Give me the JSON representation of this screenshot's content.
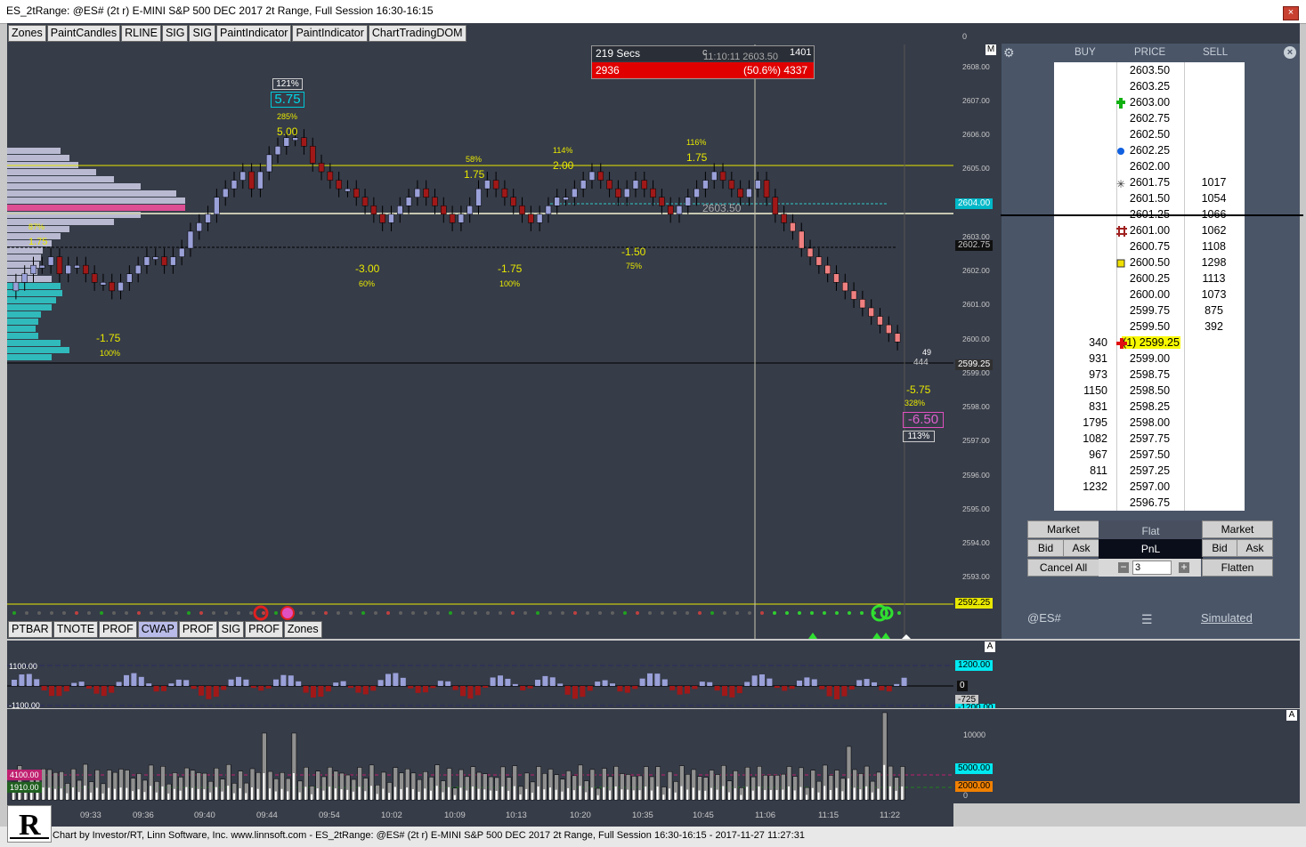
{
  "window": {
    "title": "ES_2tRange: @ES# (2t r) E-MINI S&P 500 DEC 2017 2t Range, Full Session 16:30-16:15",
    "close_label": "×"
  },
  "toolbar_top": [
    "Zones",
    "PaintCandles",
    "RLINE",
    "SIG",
    "SIG",
    "PaintIndicator",
    "PaintIndicator",
    "ChartTradingDOM"
  ],
  "toolbar_bottom": [
    {
      "label": "PTBAR",
      "active": false
    },
    {
      "label": "TNOTE",
      "active": false
    },
    {
      "label": "PROF",
      "active": false
    },
    {
      "label": "CWAP",
      "active": true
    },
    {
      "label": "PROF",
      "active": false
    },
    {
      "label": "SIG",
      "active": false
    },
    {
      "label": "PROF",
      "active": false
    },
    {
      "label": "Zones",
      "active": false
    }
  ],
  "timer_box": {
    "secs": "219 Secs",
    "count": "2936",
    "c_label": "c",
    "price_info": "11:10:11 2603.50",
    "pct_info": "(50.6%) 4337",
    "mini": "1401"
  },
  "price_axis": {
    "ticks": [
      "2608.00",
      "2607.00",
      "2606.00",
      "2605.00",
      "2604.00",
      "2603.00",
      "2602.00",
      "2601.00",
      "2600.00",
      "2599.00",
      "2598.00",
      "2597.00",
      "2596.00",
      "2595.00",
      "2594.00",
      "2593.00"
    ],
    "top_label": "0",
    "m_label": "M",
    "tags": [
      {
        "text": "2604.00",
        "bg": "#00b8c8",
        "fg": "#ffffff"
      },
      {
        "text": "2602.75",
        "bg": "#101010",
        "fg": "#c8c8c8"
      },
      {
        "text": "2599.25",
        "bg": "#303030",
        "fg": "#ffffff"
      },
      {
        "text": "2592.25",
        "bg": "#e8e800",
        "fg": "#000000"
      }
    ]
  },
  "annotations": {
    "peak_pct_box": "121%",
    "peak_value_box": "5.75",
    "peak_pct2": "285%",
    "peak_value": "5.00",
    "left_pct": "87%",
    "left_value": "1.75",
    "low1_value": "-1.75",
    "low1_pct": "100%",
    "mid1_pct": "58%",
    "mid1_value": "1.75",
    "mid2_pct": "114%",
    "mid2_value": "2.00",
    "mid3_pct": "116%",
    "mid3_value": "1.75",
    "low2_value": "-3.00",
    "low2_pct": "60%",
    "low3_value": "-1.75",
    "low3_pct": "100%",
    "low4_value": "-1.50",
    "low4_pct": "75%",
    "cross_price": "2603.50",
    "last_vol_top": "49",
    "last_vol": "444",
    "end_value": "-5.75",
    "end_pct": "328%",
    "end_box_value": "-6.50",
    "end_box_pct": "113%"
  },
  "dom": {
    "headers": {
      "buy": "BUY",
      "price": "PRICE",
      "sell": "SELL"
    },
    "settings_icon": "gear-icon",
    "close_icon": "close-icon",
    "rows": [
      {
        "buy": "",
        "price": "2603.50",
        "sell": "",
        "marker": ""
      },
      {
        "buy": "",
        "price": "2603.25",
        "sell": "",
        "marker": ""
      },
      {
        "buy": "",
        "price": "2603.00",
        "sell": "",
        "marker": "green-plus"
      },
      {
        "buy": "",
        "price": "2602.75",
        "sell": "",
        "marker": ""
      },
      {
        "buy": "",
        "price": "2602.50",
        "sell": "",
        "marker": ""
      },
      {
        "buy": "",
        "price": "2602.25",
        "sell": "",
        "marker": "blue-dot"
      },
      {
        "buy": "",
        "price": "2602.00",
        "sell": "",
        "marker": ""
      },
      {
        "buy": "",
        "price": "2601.75",
        "sell": "1017",
        "marker": "star"
      },
      {
        "buy": "",
        "price": "2601.50",
        "sell": "1054",
        "marker": ""
      },
      {
        "buy": "",
        "price": "2601.25",
        "sell": "1066",
        "marker": "line"
      },
      {
        "buy": "",
        "price": "2601.00",
        "sell": "1062",
        "marker": "hash"
      },
      {
        "buy": "",
        "price": "2600.75",
        "sell": "1108",
        "marker": ""
      },
      {
        "buy": "",
        "price": "2600.50",
        "sell": "1298",
        "marker": "yellow-square"
      },
      {
        "buy": "",
        "price": "2600.25",
        "sell": "1113",
        "marker": ""
      },
      {
        "buy": "",
        "price": "2600.00",
        "sell": "1073",
        "marker": ""
      },
      {
        "buy": "",
        "price": "2599.75",
        "sell": "875",
        "marker": ""
      },
      {
        "buy": "",
        "price": "2599.50",
        "sell": "392",
        "marker": ""
      },
      {
        "buy": "340",
        "price": "(1) 2599.25",
        "sell": "",
        "marker": "red-plus"
      },
      {
        "buy": "931",
        "price": "2599.00",
        "sell": "",
        "marker": ""
      },
      {
        "buy": "973",
        "price": "2598.75",
        "sell": "",
        "marker": ""
      },
      {
        "buy": "1150",
        "price": "2598.50",
        "sell": "",
        "marker": ""
      },
      {
        "buy": "831",
        "price": "2598.25",
        "sell": "",
        "marker": ""
      },
      {
        "buy": "1795",
        "price": "2598.00",
        "sell": "",
        "marker": ""
      },
      {
        "buy": "1082",
        "price": "2597.75",
        "sell": "",
        "marker": ""
      },
      {
        "buy": "967",
        "price": "2597.50",
        "sell": "",
        "marker": ""
      },
      {
        "buy": "811",
        "price": "2597.25",
        "sell": "",
        "marker": ""
      },
      {
        "buy": "1232",
        "price": "2597.00",
        "sell": "",
        "marker": ""
      },
      {
        "buy": "",
        "price": "2596.75",
        "sell": "",
        "marker": ""
      }
    ],
    "buttons": {
      "market_left": "Market",
      "flat": "Flat",
      "market_right": "Market",
      "bid_left": "Bid",
      "ask_left": "Ask",
      "pnl": "PnL",
      "bid_right": "Bid",
      "ask_right": "Ask",
      "cancel_all": "Cancel All",
      "qty": "3",
      "flatten": "Flatten"
    },
    "symbol": "@ES#",
    "simulated": "Simulated"
  },
  "osc_panel": {
    "upper": "1100.00",
    "lower": "-1100.00",
    "a_label": "A",
    "tag_upper": "1200.00",
    "tag_zero": "0",
    "tag_neg": "-725",
    "tag_lower": "-1200.00"
  },
  "vol_panel": {
    "left1": "4100.00",
    "left2": "1910.00",
    "a_label": "A",
    "tick_10000": "10000",
    "tag_5000": "5000.00",
    "tag_2000": "2000.00",
    "tick_0": "0"
  },
  "time_axis": [
    "09:33",
    "09:36",
    "09:40",
    "09:44",
    "09:54",
    "10:02",
    "10:09",
    "10:13",
    "10:20",
    "10:35",
    "10:45",
    "11:06",
    "11:15",
    "11:22"
  ],
  "footer": "Chart by Investor/RT, Linn Software, Inc. www.linnsoft.com - ES_2tRange: @ES# (2t r) E-MINI S&P 500 DEC 2017 2t Range, Full Session 16:30-16:15 - 2017-11-27 11:27:31",
  "chart_data": {
    "type": "candlestick",
    "y_range": [
      2592.25,
      2608.25
    ],
    "closes": [
      2601.0,
      2601.25,
      2601.5,
      2601.5,
      2601.75,
      2601.25,
      2601.5,
      2601.5,
      2601.25,
      2601.0,
      2601.0,
      2600.75,
      2601.0,
      2601.25,
      2601.5,
      2601.75,
      2601.75,
      2601.5,
      2601.75,
      2602.0,
      2602.5,
      2602.75,
      2603.0,
      2603.5,
      2603.75,
      2604.0,
      2604.25,
      2603.75,
      2604.25,
      2604.75,
      2605.0,
      2605.25,
      2605.25,
      2605.0,
      2604.5,
      2604.25,
      2604.0,
      2603.75,
      2603.75,
      2603.5,
      2603.25,
      2603.0,
      2602.75,
      2603.0,
      2603.25,
      2603.5,
      2603.75,
      2603.5,
      2603.25,
      2603.0,
      2602.75,
      2603.0,
      2603.25,
      2603.75,
      2604.0,
      2603.75,
      2603.5,
      2603.25,
      2603.0,
      2602.75,
      2603.0,
      2603.25,
      2603.5,
      2603.5,
      2603.75,
      2604.0,
      2604.25,
      2604.0,
      2603.75,
      2603.5,
      2603.75,
      2604.0,
      2603.75,
      2603.5,
      2603.25,
      2603.0,
      2603.25,
      2603.5,
      2603.75,
      2604.0,
      2604.25,
      2604.0,
      2603.75,
      2603.5,
      2603.75,
      2604.0,
      2603.5,
      2603.0,
      2602.75,
      2602.5,
      2602.0,
      2601.75,
      2601.5,
      2601.25,
      2601.0,
      2600.75,
      2600.5,
      2600.25,
      2600.0,
      2599.75,
      2599.5,
      2599.25
    ],
    "poc": 2603.75,
    "last": 2599.25
  }
}
